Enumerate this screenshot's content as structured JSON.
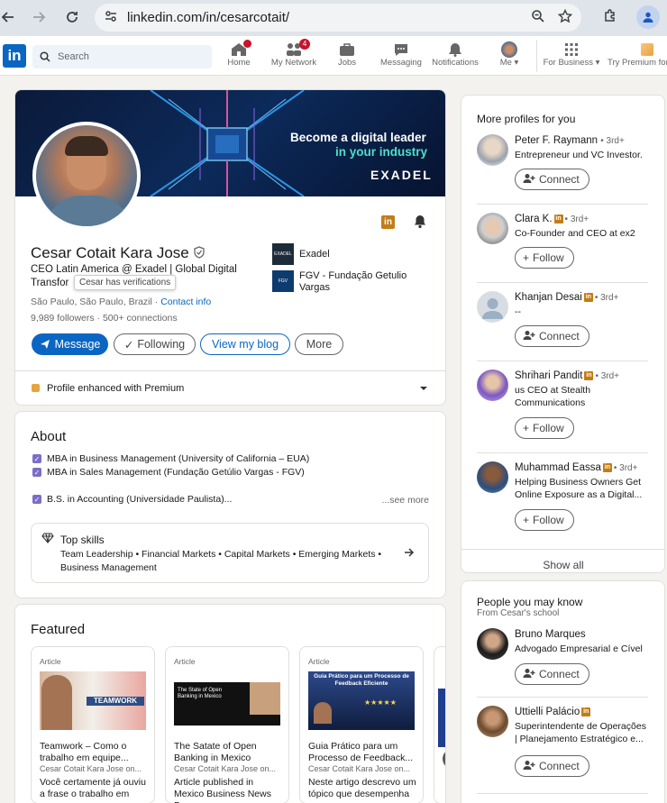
{
  "browser": {
    "url": "linkedin.com/in/cesarcotait/"
  },
  "nav": {
    "logo": "in",
    "search_placeholder": "Search",
    "items": [
      {
        "label": "Home",
        "badge": ""
      },
      {
        "label": "My Network",
        "badge": "4"
      },
      {
        "label": "Jobs",
        "badge": ""
      },
      {
        "label": "Messaging",
        "badge": ""
      },
      {
        "label": "Notifications",
        "badge": ""
      },
      {
        "label": "Me ▾",
        "badge": ""
      },
      {
        "label": "For Business ▾",
        "badge": ""
      },
      {
        "label": "Try Premium for",
        "badge": ""
      }
    ]
  },
  "profile": {
    "banner_line1": "Become a digital leader",
    "banner_line2": "in your industry",
    "banner_brand": "EXADEL",
    "name": "Cesar Cotait Kara Jose",
    "headline": "CEO Latin America @ Exadel | Global Digital Transfor",
    "tooltip": "Cesar has verifications",
    "location": "São Paulo, São Paulo, Brazil",
    "contact_info": "Contact info",
    "followers": "9,989 followers",
    "connections": "500+ connections",
    "buttons": {
      "message": "Message",
      "following": "Following",
      "blog": "View my blog",
      "more": "More"
    },
    "companies": [
      {
        "name": "Exadel",
        "logo": "EXADEL"
      },
      {
        "name": "FGV - Fundação Getulio Vargas",
        "logo": "FGV"
      }
    ],
    "premium_text": "Profile enhanced with Premium"
  },
  "about": {
    "title": "About",
    "items": [
      "MBA in Business Management (University of California – EUA)",
      "MBA in Sales Management (Fundação Getúlio Vargas - FGV)",
      "B.S. in Accounting (Universidade Paulista)..."
    ],
    "see_more": "...see more",
    "skills_title": "Top skills",
    "skills_text": "Team Leadership • Financial Markets • Capital Markets • Emerging Markets • Business Management"
  },
  "featured": {
    "title": "Featured",
    "items": [
      {
        "type": "Article",
        "title": "Teamwork – Como o trabalho em equipe...",
        "author": "Cesar Cotait Kara Jose on...",
        "desc": "Você certamente já ouviu a frase o trabalho em",
        "img_text": "TEAMWORK"
      },
      {
        "type": "Article",
        "title": "The Satate of Open Banking in Mexico",
        "author": "Cesar Cotait Kara Jose on...",
        "desc": "Article published in Mexico Business News By",
        "img_text": "The State of Open Banking in Mexico"
      },
      {
        "type": "Article",
        "title": "Guia Prático para um Processo de Feedback...",
        "author": "Cesar Cotait Kara Jose on...",
        "desc": "Neste artigo descrevo um tópico que desempenha",
        "img_text": "Guia Prático para um Processo de Feedback Eficiente"
      }
    ]
  },
  "sidebar": {
    "more_profiles_title": "More profiles for you",
    "more_profiles": [
      {
        "name": "Peter F. Raymann",
        "degree": "• 3rd+",
        "premium": false,
        "headline": "Entrepreneur und VC Investor.",
        "action": "Connect"
      },
      {
        "name": "Clara K.",
        "degree": "• 3rd+",
        "premium": true,
        "headline": "Co-Founder and CEO at ex2",
        "action": "Follow"
      },
      {
        "name": "Khanjan Desai",
        "degree": "• 3rd+",
        "premium": true,
        "headline": "--",
        "action": "Connect"
      },
      {
        "name": "Shrihari Pandit",
        "degree": "• 3rd+",
        "premium": true,
        "headline": "us CEO at Stealth Communications",
        "action": "Follow"
      },
      {
        "name": "Muhammad Eassa",
        "degree": "• 3rd+",
        "premium": true,
        "headline": "Helping Business Owners Get Online Exposure as a Digital...",
        "action": "Follow"
      }
    ],
    "show_all": "Show all",
    "pymk_title": "People you may know",
    "pymk_sub": "From Cesar's school",
    "pymk": [
      {
        "name": "Bruno Marques",
        "premium": false,
        "headline": "Advogado Empresarial e Cível",
        "action": "Connect"
      },
      {
        "name": "Uttielli Palácio",
        "premium": true,
        "headline": "Superintendente de Operações | Planejamento Estratégico e...",
        "action": "Connect"
      }
    ]
  },
  "colors": {
    "brand": "#0a66c2",
    "premium_gold": "#c37d16",
    "page_bg": "#f4f2ee"
  }
}
